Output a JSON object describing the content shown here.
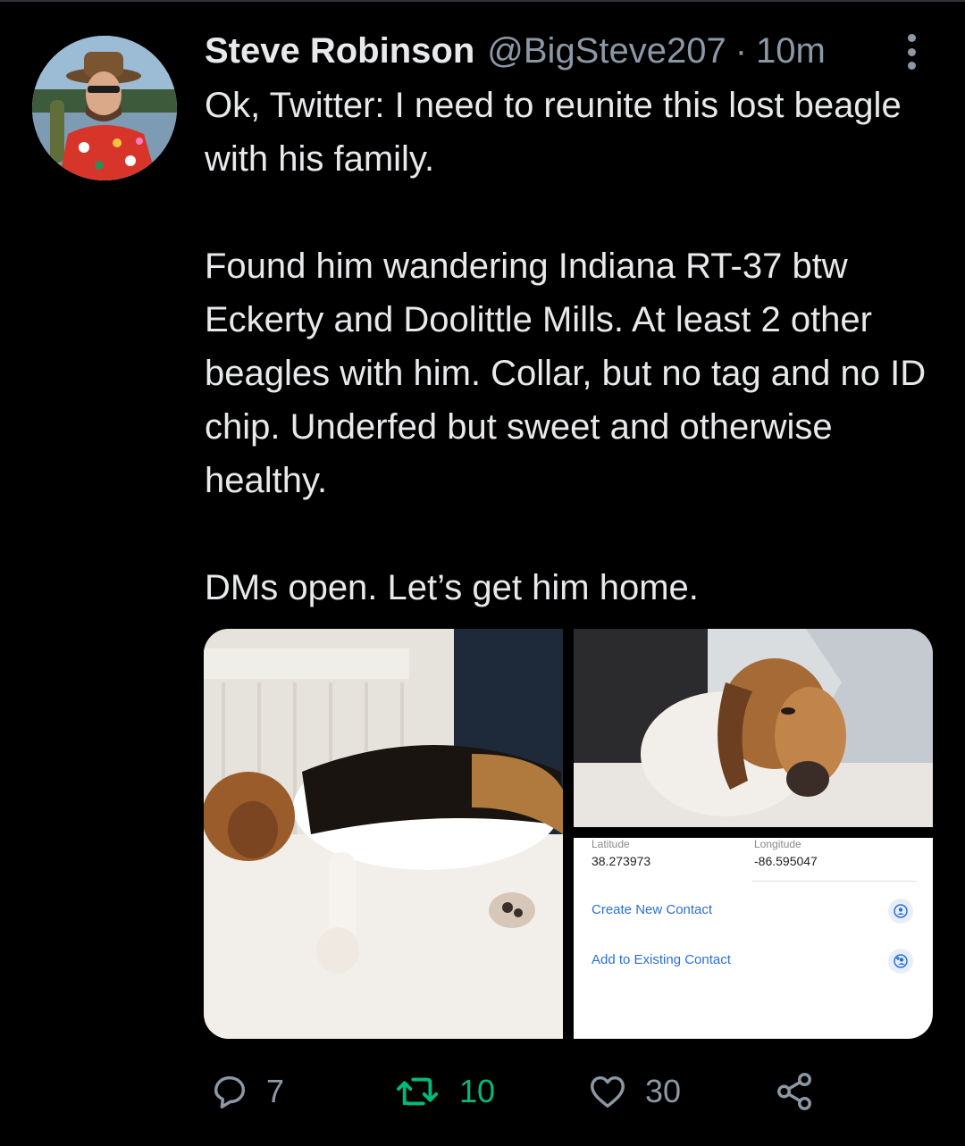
{
  "tweet": {
    "author_name": "Steve Robinson",
    "handle": "@BigSteve207",
    "separator": "·",
    "time": "10m",
    "paragraphs": [
      "Ok, Twitter: I need to reunite this lost beagle with his family.",
      "Found him wandering Indiana RT-37 btw Eckerty and Doolittle Mills. At least 2 other beagles with him. Collar, but no tag and no ID chip. Underfed but sweet and otherwise healthy.",
      "DMs open. Let’s get him home."
    ]
  },
  "location_card": {
    "latitude_label": "Latitude",
    "latitude_value": "38.273973",
    "longitude_label": "Longitude",
    "longitude_value": "-86.595047",
    "create_contact": "Create New Contact",
    "add_existing_contact": "Add to Existing Contact"
  },
  "actions": {
    "replies": "7",
    "retweets": "10",
    "likes": "30"
  },
  "colors": {
    "background": "#000000",
    "text_primary": "#e7e9ea",
    "text_secondary": "#8b98a5",
    "retweet_active": "#00ba7c",
    "link_blue": "#2a6fd6"
  },
  "icons": [
    "more-icon",
    "reply-icon",
    "retweet-icon",
    "like-icon",
    "share-icon",
    "contact-icon",
    "add-contact-icon"
  ]
}
